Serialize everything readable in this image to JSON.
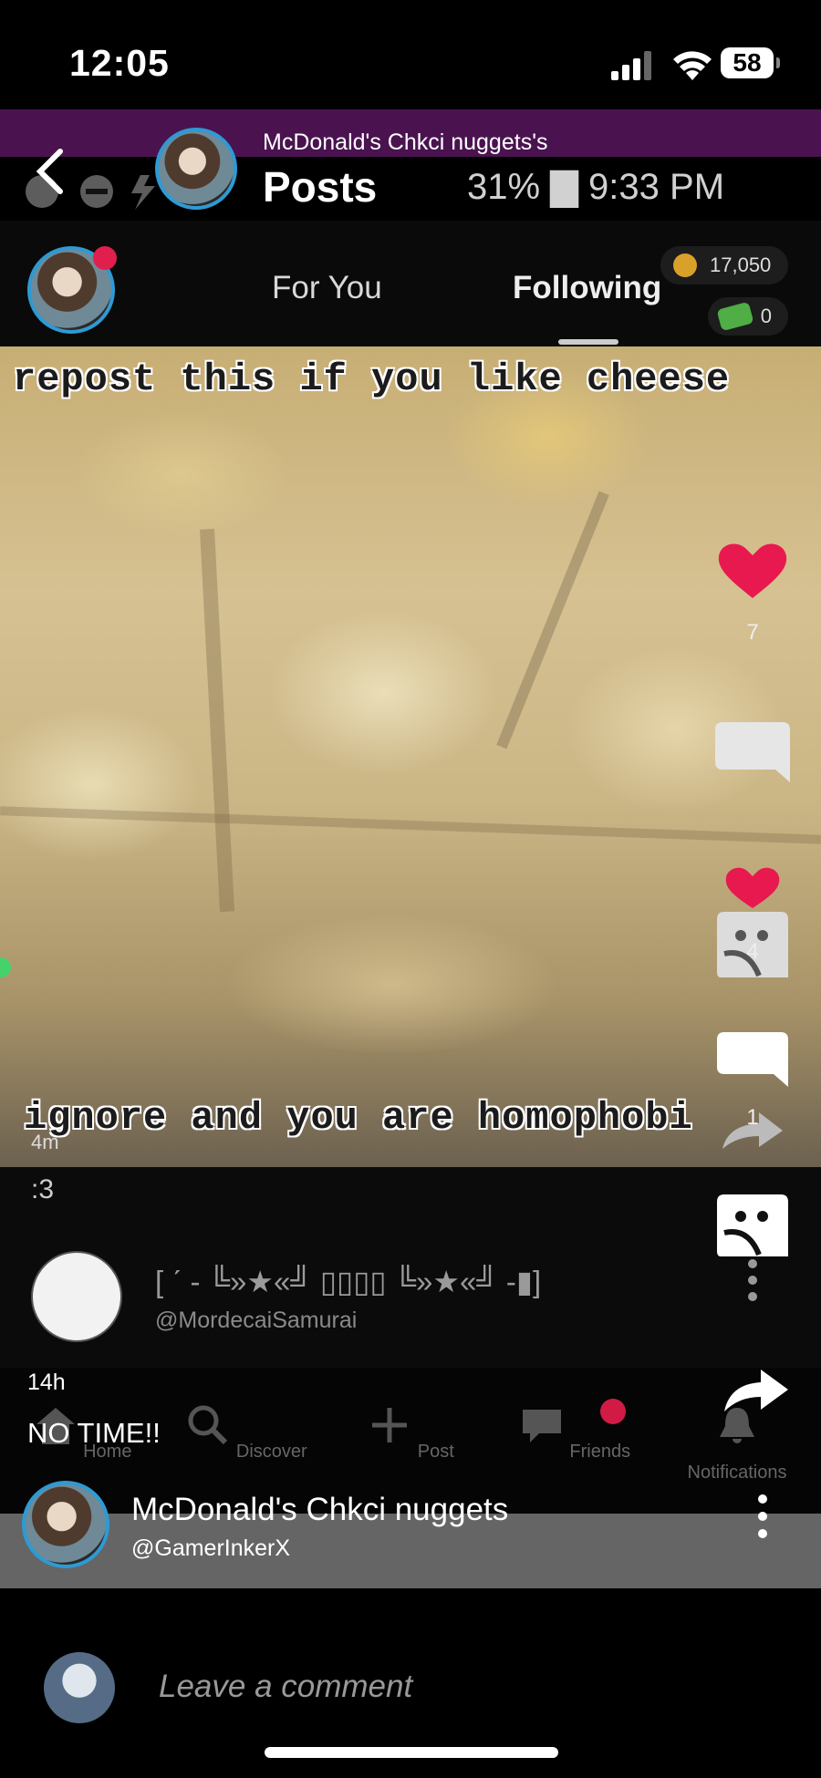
{
  "status_bar": {
    "time": "12:05",
    "battery": "58"
  },
  "header": {
    "subtitle": "McDonald's Chkci nuggets's",
    "title": "Posts",
    "android_status": "31% ▇ 9:33 PM"
  },
  "tabs": {
    "for_you": "For You",
    "following": "Following"
  },
  "wallet": {
    "coins": "17,050",
    "props": "0"
  },
  "post": {
    "meme_top": "repost this if you like cheese",
    "meme_bottom": "ignore and you are homophobi",
    "video_time": "4m",
    "caption_behind": ":3",
    "repost_user_name": "[ ˊ - ╚»★«╝ ▯▯▯▯ ╚»★«╝ -▮]",
    "repost_user_handle": "@MordecaiSamurai",
    "time": "14h",
    "caption": "NO TIME!!"
  },
  "actions": {
    "likes": "7",
    "reposts_behind": "4",
    "comments": "1"
  },
  "bottom_nav": {
    "home": "Home",
    "discover": "Discover",
    "post": "Post",
    "friends": "Friends",
    "notifications": "Notifications"
  },
  "author": {
    "name": "McDonald's Chkci nuggets",
    "handle": "@GamerInkerX"
  },
  "comment": {
    "placeholder": "Leave a comment"
  },
  "colors": {
    "accent_purple": "#4a1350",
    "like_red": "#e8194f",
    "avatar_ring": "#2e9ad4"
  }
}
